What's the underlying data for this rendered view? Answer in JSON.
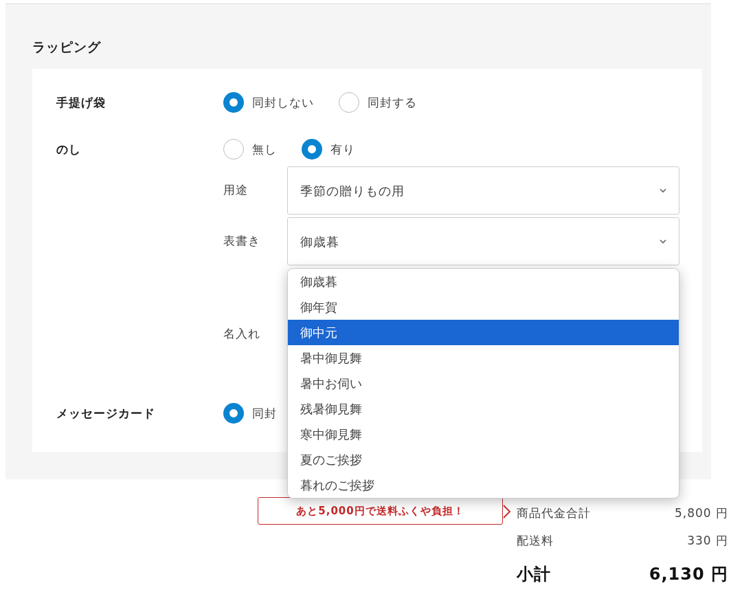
{
  "section": {
    "title": "ラッピング"
  },
  "bag": {
    "label": "手提げ袋",
    "options": [
      {
        "label": "同封しない",
        "selected": true
      },
      {
        "label": "同封する",
        "selected": false
      }
    ]
  },
  "noshi": {
    "label": "のし",
    "options": [
      {
        "label": "無し",
        "selected": false
      },
      {
        "label": "有り",
        "selected": true
      }
    ],
    "purpose": {
      "label": "用途",
      "value": "季節の贈りもの用"
    },
    "inscription": {
      "label": "表書き",
      "value": "御歳暮",
      "expanded": true,
      "options": [
        {
          "label": "御歳暮",
          "highlighted": false
        },
        {
          "label": "御年賀",
          "highlighted": false
        },
        {
          "label": "御中元",
          "highlighted": true
        },
        {
          "label": "暑中御見舞",
          "highlighted": false
        },
        {
          "label": "暑中お伺い",
          "highlighted": false
        },
        {
          "label": "残暑御見舞",
          "highlighted": false
        },
        {
          "label": "寒中御見舞",
          "highlighted": false
        },
        {
          "label": "夏のご挨拶",
          "highlighted": false
        },
        {
          "label": "暮れのご挨拶",
          "highlighted": false
        }
      ]
    },
    "name_label": "名入れ"
  },
  "message_card": {
    "label": "メッセージカード",
    "options": [
      {
        "label": "同封",
        "selected": true
      }
    ]
  },
  "summary": {
    "banner": "あと5,000円で送料ふくや負担！",
    "rows": [
      {
        "kind": "normal",
        "label": "商品代金合計",
        "value": "5,800 円"
      },
      {
        "kind": "normal",
        "label": "配送料",
        "value": "330 円"
      },
      {
        "kind": "total",
        "label": "小計",
        "value": "6,130 円"
      }
    ]
  }
}
